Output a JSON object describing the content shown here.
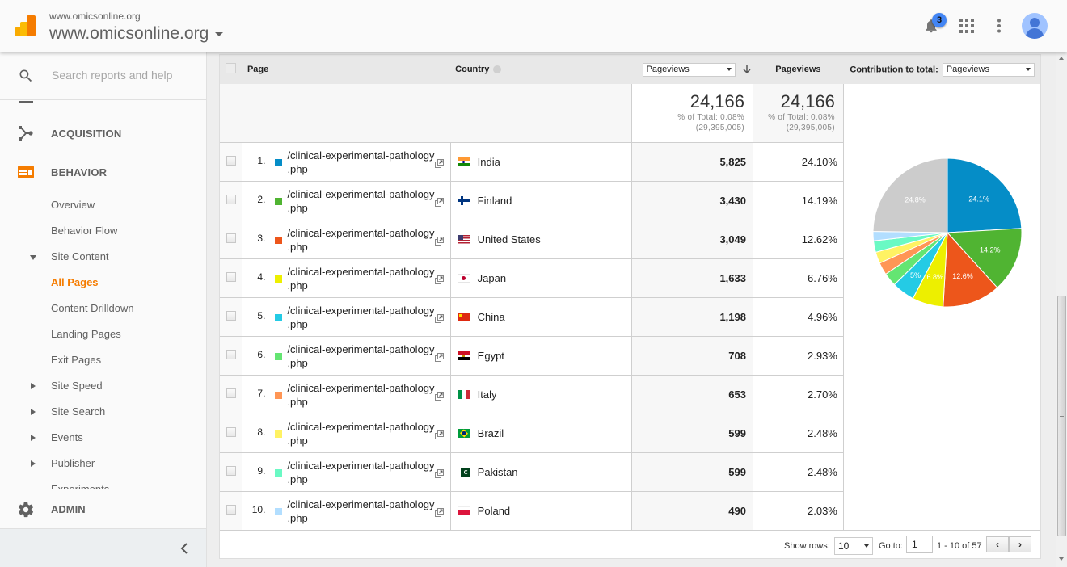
{
  "header": {
    "account_small": "www.omicsonline.org",
    "account_name": "www.omicsonline.org",
    "notification_count": "3"
  },
  "sidebar": {
    "search_placeholder": "Search reports and help",
    "sections": [
      {
        "label": "ACQUISITION",
        "icon": "acquisition-icon"
      },
      {
        "label": "BEHAVIOR",
        "icon": "behavior-icon"
      }
    ],
    "behavior_items": [
      {
        "label": "Overview"
      },
      {
        "label": "Behavior Flow"
      },
      {
        "label": "Site Content",
        "expander": "expanded"
      },
      {
        "label": "All Pages",
        "active": true
      },
      {
        "label": "Content Drilldown"
      },
      {
        "label": "Landing Pages"
      },
      {
        "label": "Exit Pages"
      },
      {
        "label": "Site Speed",
        "expander": "collapsed"
      },
      {
        "label": "Site Search",
        "expander": "collapsed"
      },
      {
        "label": "Events",
        "expander": "collapsed"
      },
      {
        "label": "Publisher",
        "expander": "collapsed"
      },
      {
        "label": "Experiments"
      }
    ],
    "admin_label": "ADMIN"
  },
  "table": {
    "headers": {
      "page": "Page",
      "country": "Country",
      "metric_select": "Pageviews",
      "pageviews": "Pageviews",
      "contribution_label": "Contribution to total:",
      "contribution_select": "Pageviews"
    },
    "totals": {
      "metric_value": "24,166",
      "metric_pct": "% of Total: 0.08%",
      "metric_total": "(29,395,005)",
      "pv_value": "24,166",
      "pv_pct": "% of Total: 0.08%",
      "pv_total": "(29,395,005)"
    },
    "rows": [
      {
        "rank": "1.",
        "page": "/clinical-experimental-pathology",
        "page2": ".php",
        "country": "India",
        "flag": "india",
        "color": "#058dc7",
        "pageviews": "5,825",
        "pct": "24.10%"
      },
      {
        "rank": "2.",
        "page": "/clinical-experimental-pathology",
        "page2": ".php",
        "country": "Finland",
        "flag": "finland",
        "color": "#50b432",
        "pageviews": "3,430",
        "pct": "14.19%"
      },
      {
        "rank": "3.",
        "page": "/clinical-experimental-pathology",
        "page2": ".php",
        "country": "United States",
        "flag": "us",
        "color": "#ed561b",
        "pageviews": "3,049",
        "pct": "12.62%"
      },
      {
        "rank": "4.",
        "page": "/clinical-experimental-pathology",
        "page2": ".php",
        "country": "Japan",
        "flag": "japan",
        "color": "#edef00",
        "pageviews": "1,633",
        "pct": "6.76%"
      },
      {
        "rank": "5.",
        "page": "/clinical-experimental-pathology",
        "page2": ".php",
        "country": "China",
        "flag": "china",
        "color": "#24cbe5",
        "pageviews": "1,198",
        "pct": "4.96%"
      },
      {
        "rank": "6.",
        "page": "/clinical-experimental-pathology",
        "page2": ".php",
        "country": "Egypt",
        "flag": "egypt",
        "color": "#64e572",
        "pageviews": "708",
        "pct": "2.93%"
      },
      {
        "rank": "7.",
        "page": "/clinical-experimental-pathology",
        "page2": ".php",
        "country": "Italy",
        "flag": "italy",
        "color": "#ff9655",
        "pageviews": "653",
        "pct": "2.70%"
      },
      {
        "rank": "8.",
        "page": "/clinical-experimental-pathology",
        "page2": ".php",
        "country": "Brazil",
        "flag": "brazil",
        "color": "#fff263",
        "pageviews": "599",
        "pct": "2.48%"
      },
      {
        "rank": "9.",
        "page": "/clinical-experimental-pathology",
        "page2": ".php",
        "country": "Pakistan",
        "flag": "pakistan",
        "color": "#6af9c4",
        "pageviews": "599",
        "pct": "2.48%"
      },
      {
        "rank": "10.",
        "page": "/clinical-experimental-pathology",
        "page2": ".php",
        "country": "Poland",
        "flag": "poland",
        "color": "#b2deff",
        "pageviews": "490",
        "pct": "2.03%"
      }
    ]
  },
  "pie": {
    "slices": [
      {
        "value": 24.1,
        "color": "#058dc7",
        "label": "24.1%"
      },
      {
        "value": 14.19,
        "color": "#50b432",
        "label": "14.2%"
      },
      {
        "value": 12.62,
        "color": "#ed561b",
        "label": "12.6%"
      },
      {
        "value": 6.76,
        "color": "#edef00",
        "label": "6.8%"
      },
      {
        "value": 4.96,
        "color": "#24cbe5",
        "label": "5%"
      },
      {
        "value": 2.93,
        "color": "#64e572",
        "label": ""
      },
      {
        "value": 2.7,
        "color": "#ff9655",
        "label": ""
      },
      {
        "value": 2.48,
        "color": "#fff263",
        "label": ""
      },
      {
        "value": 2.48,
        "color": "#6af9c4",
        "label": ""
      },
      {
        "value": 2.03,
        "color": "#b2deff",
        "label": ""
      },
      {
        "value": 24.75,
        "color": "#cccccc",
        "label": "24.8%"
      }
    ]
  },
  "footer": {
    "show_rows_label": "Show rows:",
    "show_rows_value": "10",
    "goto_label": "Go to:",
    "goto_value": "1",
    "range_text": "1 - 10 of 57"
  }
}
